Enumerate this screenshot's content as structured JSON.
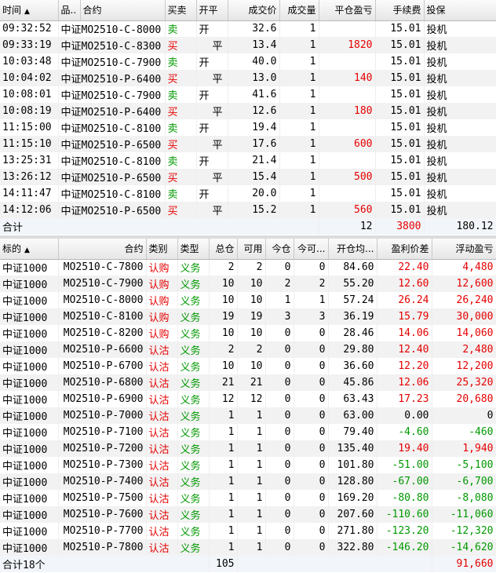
{
  "trades": {
    "headers": {
      "time": "时间",
      "sort_icon": "▲",
      "product": "品..",
      "contract": "合约",
      "side": "买卖",
      "open_close": "开平",
      "price": "成交价",
      "qty": "成交量",
      "close_pnl": "平仓盈亏",
      "fee": "手续费",
      "hedge": "投保"
    },
    "rows": [
      {
        "time": "09:32:52",
        "contract": "中证MO2510-C-8000",
        "side": "卖",
        "side_color": "#009900",
        "oc": "开",
        "price": "32.6",
        "qty": "1",
        "pnl": "",
        "fee": "15.01",
        "hedge": "投机"
      },
      {
        "time": "09:33:19",
        "contract": "中证MO2510-C-8300",
        "side": "买",
        "side_color": "#e60000",
        "oc": "平",
        "price": "13.4",
        "qty": "1",
        "pnl": "1820",
        "fee": "15.01",
        "hedge": "投机"
      },
      {
        "time": "10:03:48",
        "contract": "中证MO2510-C-7900",
        "side": "卖",
        "side_color": "#009900",
        "oc": "开",
        "price": "40.0",
        "qty": "1",
        "pnl": "",
        "fee": "15.01",
        "hedge": "投机"
      },
      {
        "time": "10:04:02",
        "contract": "中证MO2510-P-6400",
        "side": "买",
        "side_color": "#e60000",
        "oc": "平",
        "price": "13.0",
        "qty": "1",
        "pnl": "140",
        "fee": "15.01",
        "hedge": "投机"
      },
      {
        "time": "10:08:01",
        "contract": "中证MO2510-C-7900",
        "side": "卖",
        "side_color": "#009900",
        "oc": "开",
        "price": "41.6",
        "qty": "1",
        "pnl": "",
        "fee": "15.01",
        "hedge": "投机"
      },
      {
        "time": "10:08:19",
        "contract": "中证MO2510-P-6400",
        "side": "买",
        "side_color": "#e60000",
        "oc": "平",
        "price": "12.6",
        "qty": "1",
        "pnl": "180",
        "fee": "15.01",
        "hedge": "投机"
      },
      {
        "time": "11:15:00",
        "contract": "中证MO2510-C-8100",
        "side": "卖",
        "side_color": "#009900",
        "oc": "开",
        "price": "19.4",
        "qty": "1",
        "pnl": "",
        "fee": "15.01",
        "hedge": "投机"
      },
      {
        "time": "11:15:10",
        "contract": "中证MO2510-P-6500",
        "side": "买",
        "side_color": "#e60000",
        "oc": "平",
        "price": "17.6",
        "qty": "1",
        "pnl": "600",
        "fee": "15.01",
        "hedge": "投机"
      },
      {
        "time": "13:25:31",
        "contract": "中证MO2510-C-8100",
        "side": "卖",
        "side_color": "#009900",
        "oc": "开",
        "price": "21.4",
        "qty": "1",
        "pnl": "",
        "fee": "15.01",
        "hedge": "投机"
      },
      {
        "time": "13:26:12",
        "contract": "中证MO2510-P-6500",
        "side": "买",
        "side_color": "#e60000",
        "oc": "平",
        "price": "15.4",
        "qty": "1",
        "pnl": "500",
        "fee": "15.01",
        "hedge": "投机"
      },
      {
        "time": "14:11:47",
        "contract": "中证MO2510-C-8100",
        "side": "卖",
        "side_color": "#009900",
        "oc": "开",
        "price": "20.0",
        "qty": "1",
        "pnl": "",
        "fee": "15.01",
        "hedge": "投机"
      },
      {
        "time": "14:12:06",
        "contract": "中证MO2510-P-6500",
        "side": "买",
        "side_color": "#e60000",
        "oc": "平",
        "price": "15.2",
        "qty": "1",
        "pnl": "560",
        "fee": "15.01",
        "hedge": "投机"
      }
    ],
    "total": {
      "label": "合计",
      "qty": "12",
      "pnl": "3800",
      "fee": "180.12"
    }
  },
  "positions": {
    "headers": {
      "underlying": "标的",
      "sort_icon": "▲",
      "contract": "合约",
      "category": "类别",
      "type": "类型",
      "total": "总仓",
      "available": "可用",
      "today": "今仓",
      "today_avail": "今可...",
      "avg_open": "开仓均...",
      "pnl_spread": "盈利价差",
      "float_pnl": "浮动盈亏"
    },
    "rows": [
      {
        "underlying": "中证1000",
        "contract": "MO2510-C-7800",
        "category": "认购",
        "type": "义务",
        "total": "2",
        "available": "2",
        "today": "0",
        "today_avail": "0",
        "avg_open": "84.60",
        "spread": "22.40",
        "float": "4,480",
        "pnl_color": "#e60000"
      },
      {
        "underlying": "中证1000",
        "contract": "MO2510-C-7900",
        "category": "认购",
        "type": "义务",
        "total": "10",
        "available": "10",
        "today": "2",
        "today_avail": "2",
        "avg_open": "55.20",
        "spread": "12.60",
        "float": "12,600",
        "pnl_color": "#e60000"
      },
      {
        "underlying": "中证1000",
        "contract": "MO2510-C-8000",
        "category": "认购",
        "type": "义务",
        "total": "10",
        "available": "10",
        "today": "1",
        "today_avail": "1",
        "avg_open": "57.24",
        "spread": "26.24",
        "float": "26,240",
        "pnl_color": "#e60000"
      },
      {
        "underlying": "中证1000",
        "contract": "MO2510-C-8100",
        "category": "认购",
        "type": "义务",
        "total": "19",
        "available": "19",
        "today": "3",
        "today_avail": "3",
        "avg_open": "36.19",
        "spread": "15.79",
        "float": "30,000",
        "pnl_color": "#e60000"
      },
      {
        "underlying": "中证1000",
        "contract": "MO2510-C-8200",
        "category": "认购",
        "type": "义务",
        "total": "10",
        "available": "10",
        "today": "0",
        "today_avail": "0",
        "avg_open": "28.46",
        "spread": "14.06",
        "float": "14,060",
        "pnl_color": "#e60000"
      },
      {
        "underlying": "中证1000",
        "contract": "MO2510-P-6600",
        "category": "认沽",
        "type": "义务",
        "total": "2",
        "available": "2",
        "today": "0",
        "today_avail": "0",
        "avg_open": "29.80",
        "spread": "12.40",
        "float": "2,480",
        "pnl_color": "#e60000"
      },
      {
        "underlying": "中证1000",
        "contract": "MO2510-P-6700",
        "category": "认沽",
        "type": "义务",
        "total": "10",
        "available": "10",
        "today": "0",
        "today_avail": "0",
        "avg_open": "36.60",
        "spread": "12.20",
        "float": "12,200",
        "pnl_color": "#e60000"
      },
      {
        "underlying": "中证1000",
        "contract": "MO2510-P-6800",
        "category": "认沽",
        "type": "义务",
        "total": "21",
        "available": "21",
        "today": "0",
        "today_avail": "0",
        "avg_open": "45.86",
        "spread": "12.06",
        "float": "25,320",
        "pnl_color": "#e60000"
      },
      {
        "underlying": "中证1000",
        "contract": "MO2510-P-6900",
        "category": "认沽",
        "type": "义务",
        "total": "12",
        "available": "12",
        "today": "0",
        "today_avail": "0",
        "avg_open": "63.43",
        "spread": "17.23",
        "float": "20,680",
        "pnl_color": "#e60000"
      },
      {
        "underlying": "中证1000",
        "contract": "MO2510-P-7000",
        "category": "认沽",
        "type": "义务",
        "total": "1",
        "available": "1",
        "today": "0",
        "today_avail": "0",
        "avg_open": "63.00",
        "spread": "0.00",
        "float": "0",
        "pnl_color": "#000000"
      },
      {
        "underlying": "中证1000",
        "contract": "MO2510-P-7100",
        "category": "认沽",
        "type": "义务",
        "total": "1",
        "available": "1",
        "today": "0",
        "today_avail": "0",
        "avg_open": "79.40",
        "spread": "-4.60",
        "float": "-460",
        "pnl_color": "#009900"
      },
      {
        "underlying": "中证1000",
        "contract": "MO2510-P-7200",
        "category": "认沽",
        "type": "义务",
        "total": "1",
        "available": "1",
        "today": "0",
        "today_avail": "0",
        "avg_open": "135.40",
        "spread": "19.40",
        "float": "1,940",
        "pnl_color": "#e60000"
      },
      {
        "underlying": "中证1000",
        "contract": "MO2510-P-7300",
        "category": "认沽",
        "type": "义务",
        "total": "1",
        "available": "1",
        "today": "0",
        "today_avail": "0",
        "avg_open": "101.80",
        "spread": "-51.00",
        "float": "-5,100",
        "pnl_color": "#009900"
      },
      {
        "underlying": "中证1000",
        "contract": "MO2510-P-7400",
        "category": "认沽",
        "type": "义务",
        "total": "1",
        "available": "1",
        "today": "0",
        "today_avail": "0",
        "avg_open": "128.80",
        "spread": "-67.00",
        "float": "-6,700",
        "pnl_color": "#009900"
      },
      {
        "underlying": "中证1000",
        "contract": "MO2510-P-7500",
        "category": "认沽",
        "type": "义务",
        "total": "1",
        "available": "1",
        "today": "0",
        "today_avail": "0",
        "avg_open": "169.20",
        "spread": "-80.80",
        "float": "-8,080",
        "pnl_color": "#009900"
      },
      {
        "underlying": "中证1000",
        "contract": "MO2510-P-7600",
        "category": "认沽",
        "type": "义务",
        "total": "1",
        "available": "1",
        "today": "0",
        "today_avail": "0",
        "avg_open": "207.60",
        "spread": "-110.60",
        "float": "-11,060",
        "pnl_color": "#009900"
      },
      {
        "underlying": "中证1000",
        "contract": "MO2510-P-7700",
        "category": "认沽",
        "type": "义务",
        "total": "1",
        "available": "1",
        "today": "0",
        "today_avail": "0",
        "avg_open": "271.80",
        "spread": "-123.20",
        "float": "-12,320",
        "pnl_color": "#009900"
      },
      {
        "underlying": "中证1000",
        "contract": "MO2510-P-7800",
        "category": "认沽",
        "type": "义务",
        "total": "1",
        "available": "1",
        "today": "0",
        "today_avail": "0",
        "avg_open": "322.80",
        "spread": "-146.20",
        "float": "-14,620",
        "pnl_color": "#009900"
      }
    ],
    "total": {
      "label": "合计18个",
      "total": "105",
      "float": "91,660",
      "float_color": "#e60000"
    }
  },
  "colors": {
    "buy": "#e60000",
    "sell": "#009900",
    "profit": "#e60000",
    "loss": "#009900",
    "category": "#e60000",
    "type": "#009900"
  }
}
